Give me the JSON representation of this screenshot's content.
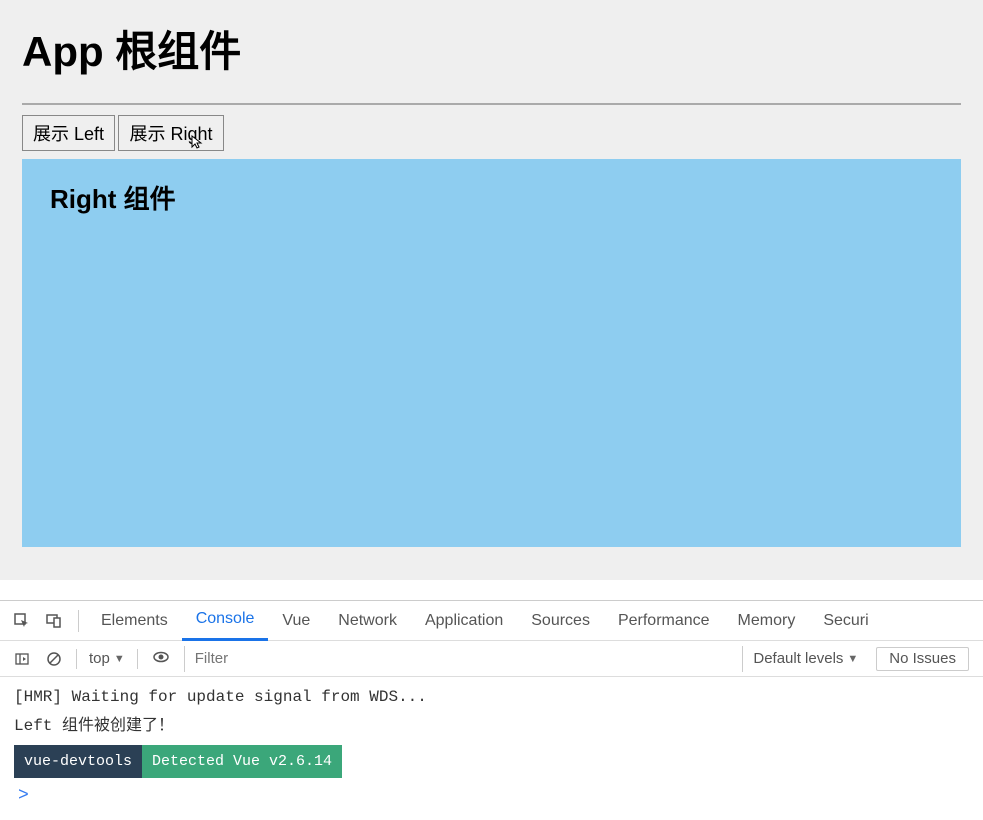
{
  "app": {
    "title": "App 根组件",
    "buttons": {
      "show_left": "展示 Left",
      "show_right": "展示 Right"
    },
    "component": {
      "title": "Right 组件"
    }
  },
  "devtools": {
    "tabs": [
      "Elements",
      "Console",
      "Vue",
      "Network",
      "Application",
      "Sources",
      "Performance",
      "Memory",
      "Securi"
    ],
    "active_tab": "Console",
    "toolbar": {
      "context": "top",
      "filter_placeholder": "Filter",
      "levels": "Default levels",
      "no_issues": "No Issues"
    },
    "console_lines": [
      "[HMR] Waiting for update signal from WDS...",
      "Left 组件被创建了！"
    ],
    "badges": {
      "devtools": "vue-devtools",
      "detected": "Detected Vue v2.6.14"
    },
    "prompt": ">"
  }
}
